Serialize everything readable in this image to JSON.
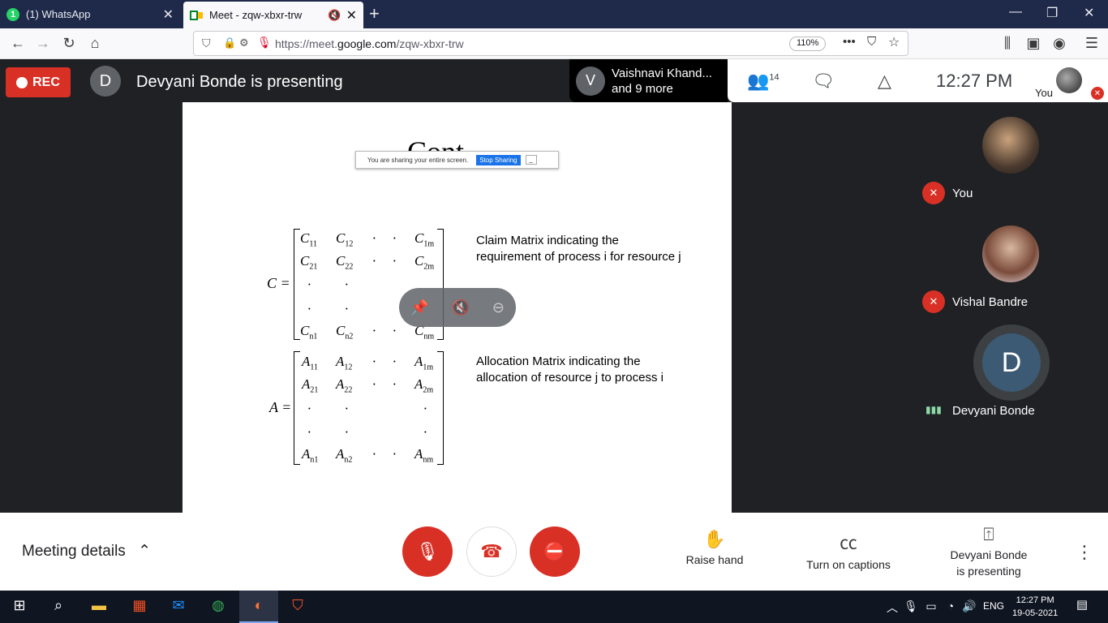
{
  "browser": {
    "tabs": [
      {
        "title": "(1) WhatsApp",
        "badge": "1"
      },
      {
        "title": "Meet - zqw-xbxr-trw"
      }
    ],
    "url_prefix": "https://meet.",
    "url_domain": "google.com",
    "url_path": "/zqw-xbxr-trw",
    "zoom": "110%"
  },
  "meet_top": {
    "rec_label": "REC",
    "presenter_initial": "D",
    "presenter_text": "Devyani Bonde is presenting",
    "popup_initial": "V",
    "popup_line1": "Vaishnavi Khand...",
    "popup_line2": "and 9 more",
    "people_count": "14",
    "clock": "12:27  PM",
    "you_label": "You"
  },
  "slide": {
    "heading": "Cont",
    "share_text": "You are sharing your entire screen.",
    "stop_sharing": "Stop Sharing",
    "minimize": "_",
    "claim_label": "C =",
    "claim_desc_line1": "Claim Matrix indicating the",
    "claim_desc_line2": "requirement of process i for resource j",
    "alloc_label": "A =",
    "alloc_desc_line1": "Allocation Matrix indicating the",
    "alloc_desc_line2": "allocation of resource j to process i"
  },
  "participants": [
    {
      "name": "You",
      "muted": true
    },
    {
      "name": "Vishal Bandre",
      "muted": true
    },
    {
      "name": "Devyani Bonde",
      "initial": "D",
      "speaking": true
    }
  ],
  "controls": {
    "meeting_details": "Meeting details",
    "raise_hand": "Raise hand",
    "captions": "Turn on captions",
    "presenting_line1": "Devyani Bonde",
    "presenting_line2": "is presenting"
  },
  "taskbar": {
    "lang": "ENG",
    "time": "12:27 PM",
    "date": "19-05-2021"
  }
}
